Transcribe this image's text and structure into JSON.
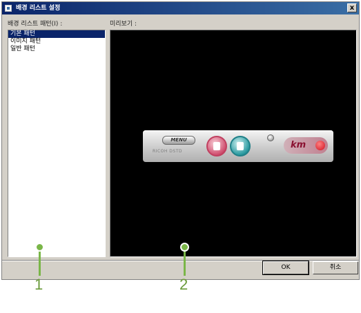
{
  "window": {
    "title": "배경 리스트 설정",
    "close_label": "x"
  },
  "list": {
    "label": "배경 리스트 패턴(I) :",
    "items": [
      {
        "label": "기본 패턴",
        "selected": true
      },
      {
        "label": "이미지 패턴",
        "selected": false
      },
      {
        "label": "일반 패턴",
        "selected": false
      }
    ]
  },
  "preview": {
    "label": "미리보기 :",
    "launcher": {
      "menu_label": "MENU",
      "brand_sub": "RICOH DSTD",
      "logo_text": "km"
    }
  },
  "buttons": {
    "ok_label": "OK",
    "cancel_label": "취소"
  },
  "callouts": {
    "one": "1",
    "two": "2"
  },
  "colors": {
    "title_bar": "#0a246a",
    "selection": "#0a246a",
    "dialog_bg": "#d4d0c8",
    "callout_green": "#7ab648"
  }
}
